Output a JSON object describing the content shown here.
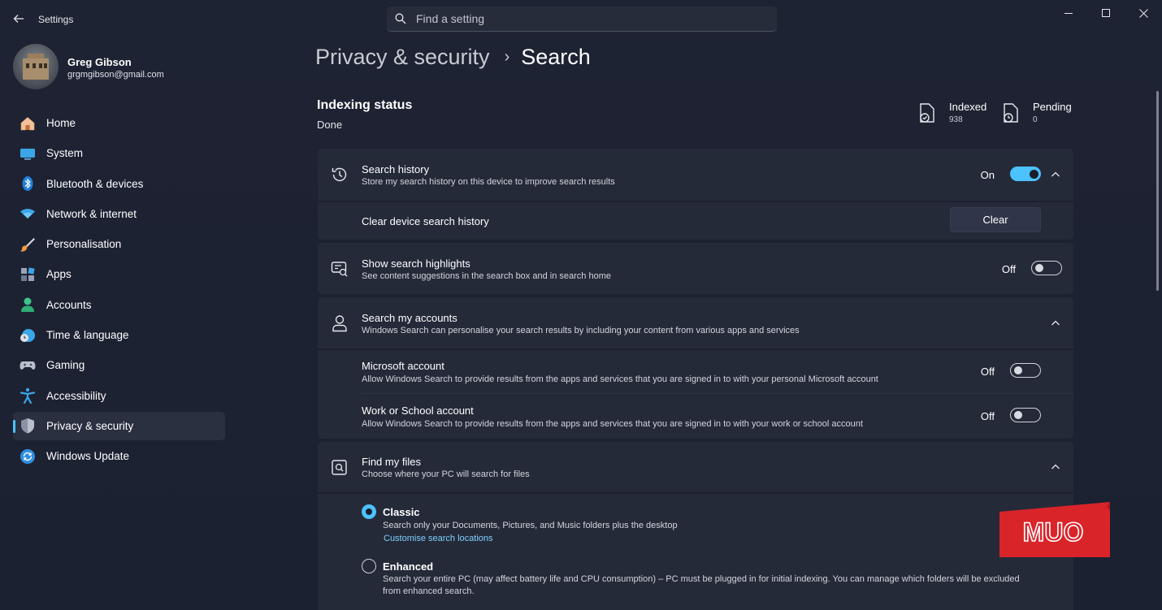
{
  "window": {
    "title": "Settings",
    "search_placeholder": "Find a setting"
  },
  "profile": {
    "name": "Greg Gibson",
    "email": "grgmgibson@gmail.com"
  },
  "nav": [
    {
      "label": "Home",
      "icon": "home-icon"
    },
    {
      "label": "System",
      "icon": "system-icon"
    },
    {
      "label": "Bluetooth & devices",
      "icon": "bluetooth-icon"
    },
    {
      "label": "Network & internet",
      "icon": "wifi-icon"
    },
    {
      "label": "Personalisation",
      "icon": "brush-icon"
    },
    {
      "label": "Apps",
      "icon": "apps-icon"
    },
    {
      "label": "Accounts",
      "icon": "accounts-icon"
    },
    {
      "label": "Time & language",
      "icon": "clock-globe-icon"
    },
    {
      "label": "Gaming",
      "icon": "gamepad-icon"
    },
    {
      "label": "Accessibility",
      "icon": "accessibility-icon"
    },
    {
      "label": "Privacy & security",
      "icon": "shield-icon",
      "active": true
    },
    {
      "label": "Windows Update",
      "icon": "update-icon"
    }
  ],
  "breadcrumb": {
    "parent": "Privacy & security",
    "separator": "›",
    "current": "Search"
  },
  "indexing": {
    "title": "Indexing status",
    "value": "Done",
    "indexed_label": "Indexed",
    "indexed_count": "938",
    "pending_label": "Pending",
    "pending_count": "0"
  },
  "search_history": {
    "title": "Search history",
    "desc": "Store my search history on this device to improve search results",
    "state": "On",
    "clear_label": "Clear device search history",
    "clear_button": "Clear"
  },
  "highlights": {
    "title": "Show search highlights",
    "desc": "See content suggestions in the search box and in search home",
    "state": "Off"
  },
  "accounts": {
    "title": "Search my accounts",
    "desc": "Windows Search can personalise your search results by including your content from various apps and services",
    "microsoft": {
      "title": "Microsoft account",
      "desc": "Allow Windows Search to provide results from the apps and services that you are signed in to with your personal Microsoft account",
      "state": "Off"
    },
    "work": {
      "title": "Work or School account",
      "desc": "Allow Windows Search to provide results from the apps and services that you are signed in to with your work or school account",
      "state": "Off"
    }
  },
  "find_files": {
    "title": "Find my files",
    "desc": "Choose where your PC will search for files",
    "classic": {
      "title": "Classic",
      "desc": "Search only your Documents, Pictures, and Music folders plus the desktop",
      "link": "Customise search locations"
    },
    "enhanced": {
      "title": "Enhanced",
      "desc1": "Search your entire PC (may affect battery life and CPU consumption) – PC must be plugged in for initial indexing. You can manage which folders will be excluded",
      "desc2": "from enhanced search."
    }
  },
  "watermark": "MUO",
  "colors": {
    "accent": "#4cc2ff",
    "background": "#1c2030",
    "card": "#252a39",
    "watermark": "#d9242a"
  }
}
